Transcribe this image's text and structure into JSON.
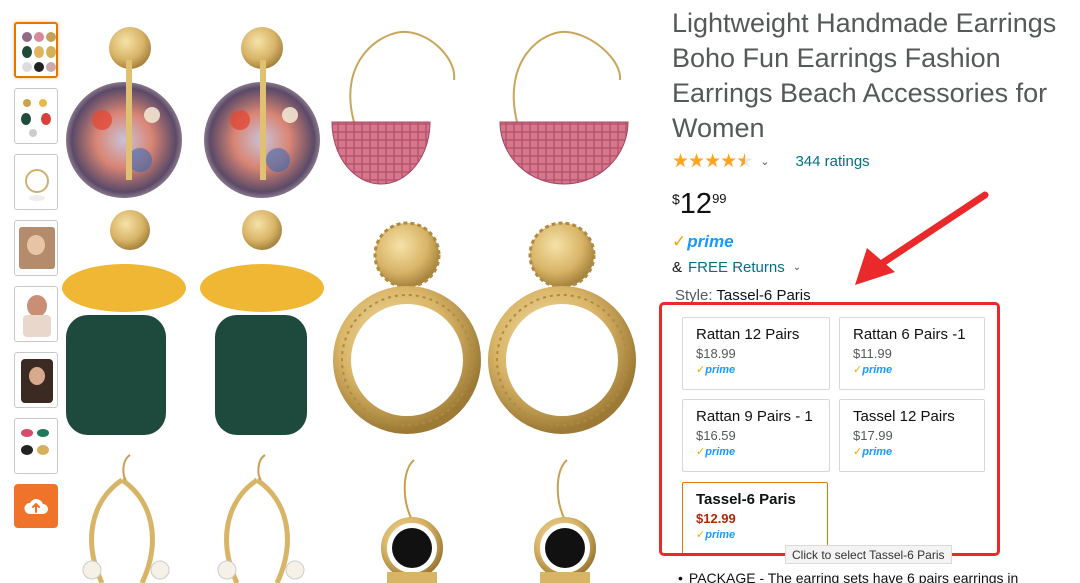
{
  "product": {
    "title": "Lightweight Handmade Earrings\nBoho Fun Earrings Fashion\nEarrings Beach Accessories for\nWomen",
    "rating_stars": 4.5,
    "ratings_count_text": "344 ratings",
    "price": {
      "symbol": "$",
      "whole": "12",
      "fraction": "99"
    },
    "prime_label": "prime",
    "returns": {
      "prefix": "&",
      "label": "FREE Returns"
    }
  },
  "style_selector": {
    "label": "Style:",
    "selected_value": "Tassel-6 Paris",
    "options": [
      {
        "name": "Rattan 12 Pairs",
        "price": "$18.99",
        "prime": "prime"
      },
      {
        "name": "Rattan 6 Pairs -1",
        "price": "$11.99",
        "prime": "prime"
      },
      {
        "name": "Rattan 9 Pairs - 1",
        "price": "$16.59",
        "prime": "prime"
      },
      {
        "name": "Tassel 12 Pairs",
        "price": "$17.99",
        "prime": "prime"
      },
      {
        "name": "Tassel-6 Paris",
        "price": "$12.99",
        "prime": "prime"
      }
    ],
    "tooltip": "Click to select Tassel-6 Paris"
  },
  "bullets": [
    "PACKAGE - The earring sets have 6 pairs earrings in"
  ],
  "colors": {
    "annotation_red": "#ea2a2a",
    "link_teal": "#007185",
    "star_orange": "#ffa41c",
    "prime_blue": "#1a98ff",
    "selected_orange": "#e77600",
    "sale_red": "#b12704"
  },
  "icons": {
    "upload": "cloud-upload-icon",
    "annotation": "red-arrow-annotation"
  }
}
